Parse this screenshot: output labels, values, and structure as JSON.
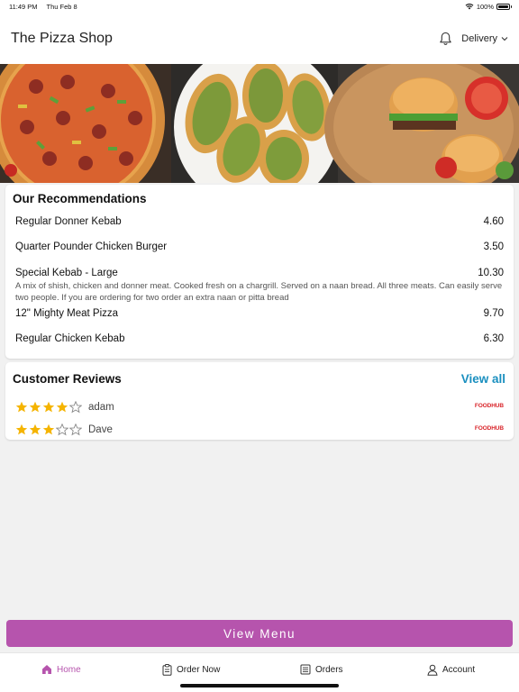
{
  "status_bar": {
    "time": "11:49 PM",
    "date": "Thu Feb 8",
    "battery": "100%"
  },
  "header": {
    "title": "The Pizza Shop",
    "delivery_label": "Delivery",
    "icons": [
      "bell-icon",
      "chevron-down-icon"
    ]
  },
  "hero": {
    "images": [
      "pizza-image",
      "garlic-bread-image",
      "burger-image"
    ]
  },
  "recommendations": {
    "title": "Our Recommendations",
    "items": [
      {
        "name": "Regular Donner Kebab",
        "price": "4.60",
        "description": ""
      },
      {
        "name": "Quarter Pounder Chicken Burger",
        "price": "3.50",
        "description": ""
      },
      {
        "name": "Special Kebab - Large",
        "price": "10.30",
        "description": "A mix of shish, chicken and donner meat. Cooked fresh on a chargrill. Served on a naan bread. All three meats. Can easily serve two people. If you are ordering for two order an extra naan or pitta bread"
      },
      {
        "name": "12\" Mighty Meat Pizza",
        "price": "9.70",
        "description": ""
      },
      {
        "name": "Regular Chicken Kebab",
        "price": "6.30",
        "description": ""
      }
    ]
  },
  "reviews": {
    "title": "Customer Reviews",
    "view_all": "View all",
    "items": [
      {
        "author": "adam",
        "rating": 4,
        "max_rating": 5,
        "source": "FOODHUB"
      },
      {
        "author": "Dave",
        "rating": 3,
        "max_rating": 5,
        "source": "FOODHUB"
      }
    ]
  },
  "view_menu": {
    "label": "View Menu"
  },
  "tabbar": {
    "tabs": [
      {
        "label": "Home",
        "icon": "home-icon",
        "active": true
      },
      {
        "label": "Order Now",
        "icon": "order-clipboard-icon",
        "active": false
      },
      {
        "label": "Orders",
        "icon": "receipt-icon",
        "active": false
      },
      {
        "label": "Account",
        "icon": "user-icon",
        "active": false
      }
    ]
  },
  "colors": {
    "accent": "#b654ad",
    "link": "#1a8fbf",
    "star": "#f5b400",
    "star_empty": "#888888",
    "foodhub": "#d9262b",
    "background": "#f1f1f1"
  }
}
